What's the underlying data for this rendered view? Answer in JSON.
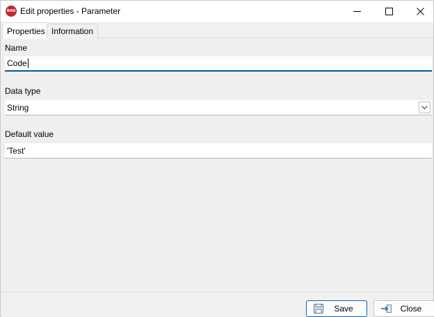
{
  "window": {
    "title": "Edit properties - Parameter",
    "app_icon_text": "RAD",
    "app_icon_color": "#c0262c"
  },
  "tabs": [
    {
      "label": "Properties",
      "active": true
    },
    {
      "label": "Information",
      "active": false
    }
  ],
  "form": {
    "name": {
      "label": "Name",
      "value": "Code"
    },
    "data_type": {
      "label": "Data type",
      "value": "String"
    },
    "default_value": {
      "label": "Default value",
      "value": "'Test'"
    }
  },
  "footer": {
    "save_label": "Save",
    "close_label": "Close"
  },
  "colors": {
    "focus_accent": "#005a9e",
    "primary_border": "#0067c0"
  }
}
